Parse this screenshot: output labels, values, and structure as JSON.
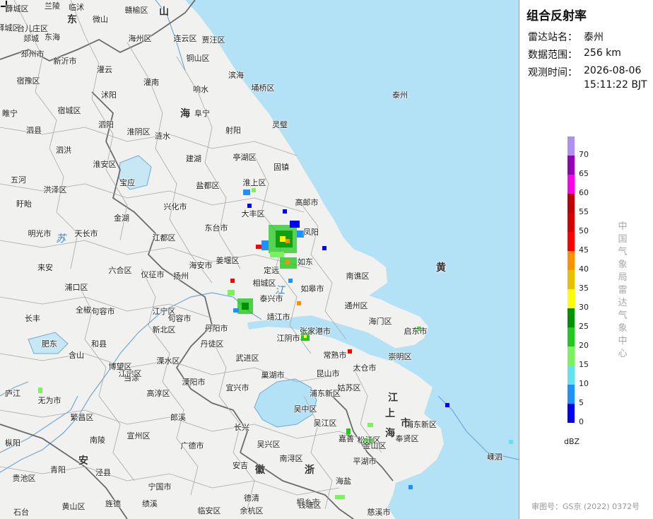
{
  "panel": {
    "title": "组合反射率",
    "station_label": "雷达站名：",
    "station_value": "泰州",
    "range_label": "数据范围：",
    "range_value": "256 km",
    "time_label": "观测时间：",
    "time_date": "2026-08-06",
    "time_clock": "15:11:22 BJT",
    "unit": "dBZ",
    "vertical_text": [
      "中",
      "国",
      "气",
      "象",
      "局",
      "雷",
      "达",
      "气",
      "象",
      "中",
      "心"
    ],
    "review_number": "审图号：GS京 (2022) 0372号"
  },
  "legend": [
    {
      "label": "0",
      "color": "#0000f6"
    },
    {
      "label": "5",
      "color": "#1e90ff"
    },
    {
      "label": "10",
      "color": "#63e2f0"
    },
    {
      "label": "15",
      "color": "#7cf260"
    },
    {
      "label": "20",
      "color": "#22c81e"
    },
    {
      "label": "25",
      "color": "#009100"
    },
    {
      "label": "30",
      "color": "#ffff00"
    },
    {
      "label": "35",
      "color": "#e7c000"
    },
    {
      "label": "40",
      "color": "#ff9000"
    },
    {
      "label": "45",
      "color": "#ff0000"
    },
    {
      "label": "50",
      "color": "#d60000"
    },
    {
      "label": "55",
      "color": "#c00000"
    },
    {
      "label": "60",
      "color": "#ff00f0"
    },
    {
      "label": "65",
      "color": "#9600b4"
    },
    {
      "label": "70",
      "color": "#ad90f0"
    }
  ],
  "map": {
    "places": [
      "薛城区",
      "兰陵",
      "临沭",
      "赣榆区",
      "山",
      "东",
      "微山",
      "峄城区",
      "台儿庄区",
      "郯城",
      "东海",
      "海州区",
      "连云区",
      "贾汪区",
      "邳州市",
      "新沂市",
      "灌云",
      "铜山区",
      "宿豫区",
      "沭阳",
      "灌南",
      "响水",
      "滨海",
      "埇桥区",
      "睢宁",
      "宿城区",
      "泗阳",
      "淮阴区",
      "涟水",
      "阜宁",
      "射阳",
      "灵璧",
      "泗县",
      "泗洪",
      "淮安区",
      "建湖",
      "亭湖区",
      "固镇",
      "五河",
      "洪泽区",
      "宝应",
      "盐都区",
      "淮上区",
      "盱眙",
      "金湖",
      "兴化市",
      "大丰区",
      "高邮市",
      "东台市",
      "凤阳",
      "明光市",
      "天长市",
      "江都区",
      "姜堰区",
      "定远",
      "来安",
      "六合区",
      "仪征市",
      "扬州",
      "海安市",
      "如东",
      "南谯区",
      "浦口区",
      "句容市",
      "泰兴市",
      "如皋市",
      "通州区",
      "长丰",
      "全椒",
      "靖江市",
      "海门区",
      "启东市",
      "肥东",
      "江宁区",
      "丹阳市",
      "武进区",
      "张家港市",
      "常熟市",
      "崇明区",
      "巢湖市",
      "含山",
      "和县",
      "江宁区",
      "溧水区",
      "宜兴市",
      "太仓市",
      "博望区",
      "当涂",
      "高淳区",
      "溧阳市",
      "长兴",
      "吴中区",
      "吴江区",
      "浦东新区",
      "庐江",
      "无为市",
      "繁昌区",
      "宣州区",
      "广德市",
      "安吉",
      "嘉善",
      "松江区",
      "奉贤区",
      "南陵",
      "郎溪",
      "吴兴区",
      "南浔区",
      "金山区",
      "平湖市",
      "嵊泗",
      "枞阳",
      "青阳",
      "泾县",
      "宁国市",
      "德清",
      "桐乡市",
      "海盐",
      "贵池区",
      "石台",
      "黄山区",
      "旌德",
      "绩溪",
      "临安区",
      "余杭区",
      "钱塘区",
      "慈溪市",
      "句容市",
      "丹徒区",
      "新北区",
      "江阴市",
      "浦东新区",
      "姑苏区",
      "昆山市",
      "相城区",
      "泰州",
      "黄",
      "海",
      "江",
      "苏",
      "安",
      "徽",
      "浙",
      "江",
      "上",
      "海",
      "市",
      "崇明"
    ],
    "provinces": [
      "江苏",
      "安徽",
      "浙江",
      "上海",
      "山东"
    ],
    "sea_labels": [
      "黄",
      "海"
    ]
  }
}
